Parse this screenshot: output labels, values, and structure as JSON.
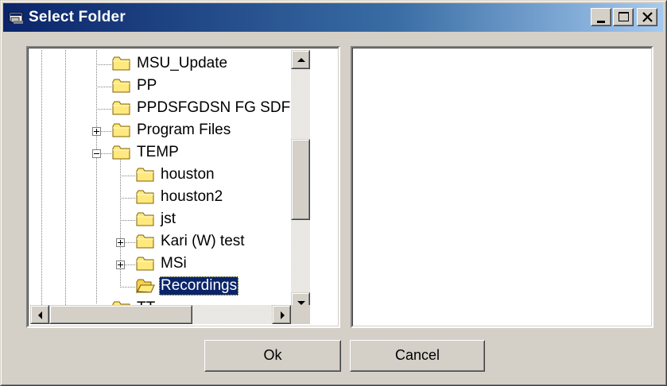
{
  "window": {
    "title": "Select Folder",
    "title_icon": "folder-browse-icon",
    "controls": [
      "minimize-icon",
      "maximize-icon",
      "close-icon"
    ]
  },
  "tree": {
    "items": [
      {
        "label": "MSU_Update",
        "expander": "none",
        "selected": false
      },
      {
        "label": "PP",
        "expander": "none",
        "selected": false
      },
      {
        "label": "PPDSFGDSN FG SDFG",
        "expander": "none",
        "selected": false
      },
      {
        "label": "Program Files",
        "expander": "plus",
        "selected": false
      },
      {
        "label": "TEMP",
        "expander": "minus",
        "selected": false
      },
      {
        "label": "houston",
        "expander": "none",
        "selected": false
      },
      {
        "label": "houston2",
        "expander": "none",
        "selected": false
      },
      {
        "label": "jst",
        "expander": "none",
        "selected": false
      },
      {
        "label": "Kari (W) test",
        "expander": "plus",
        "selected": false
      },
      {
        "label": "MSi",
        "expander": "plus",
        "selected": false
      },
      {
        "label": "Recordings",
        "expander": "none",
        "selected": true
      },
      {
        "label": "TT",
        "expander": "none",
        "selected": false
      }
    ],
    "selected_label": "Recordings"
  },
  "buttons": {
    "ok": "Ok",
    "cancel": "Cancel"
  },
  "colors": {
    "title_gradient_start": "#0a246a",
    "title_gradient_end": "#a6caf0",
    "selection": "#0a246a",
    "face": "#d4d0c8"
  }
}
